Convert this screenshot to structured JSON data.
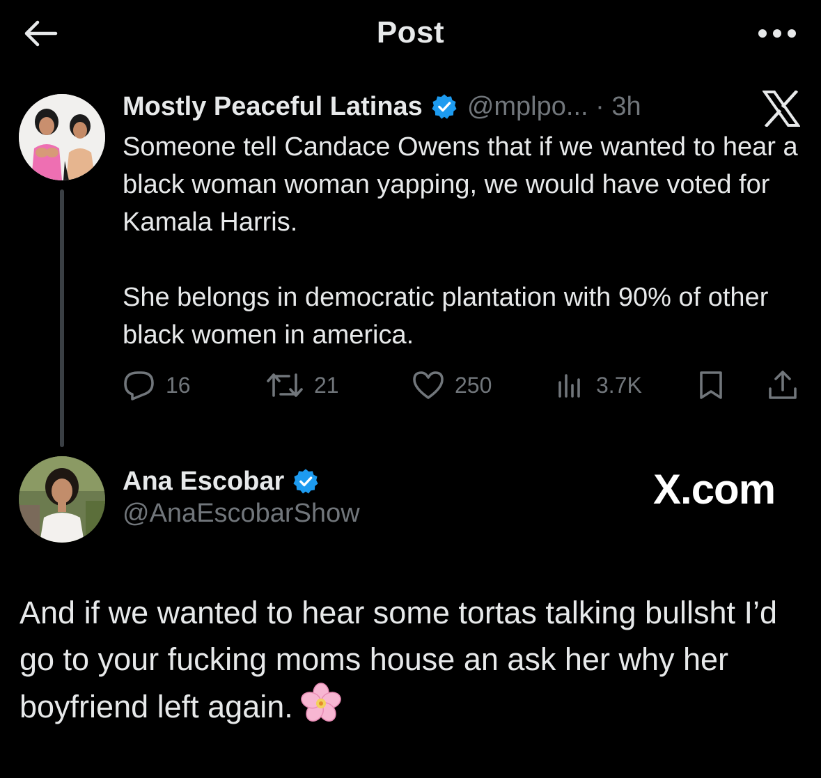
{
  "header": {
    "title": "Post",
    "back_icon": "arrow-left-icon",
    "more_icon": "more-horizontal-icon"
  },
  "original_post": {
    "display_name": "Mostly Peaceful Latinas",
    "handle_time": "@mplpo... · 3h",
    "verified": true,
    "brand_icon": "x-logo-icon",
    "text_paragraphs": [
      "Someone tell Candace Owens that if we wanted to hear a black woman woman yapping, we would have voted for Kamala Harris.",
      "She belongs in democratic plantation with 90% of other black women in america."
    ],
    "metrics": {
      "replies": "16",
      "reposts": "21",
      "likes": "250",
      "views": "3.7K"
    }
  },
  "reply_post": {
    "display_name": "Ana Escobar",
    "handle": "@AnaEscobarShow",
    "verified": true,
    "watermark": "X.com",
    "text": "And if we wanted to hear some tortas talking bullsht I’d go to your fucking moms house an ask her why her boyfriend left again."
  },
  "colors": {
    "background": "#000000",
    "text_primary": "#e7e9ea",
    "text_secondary": "#71767b",
    "verified_blue": "#1d9bf0",
    "thread_line": "#3a3f44"
  }
}
